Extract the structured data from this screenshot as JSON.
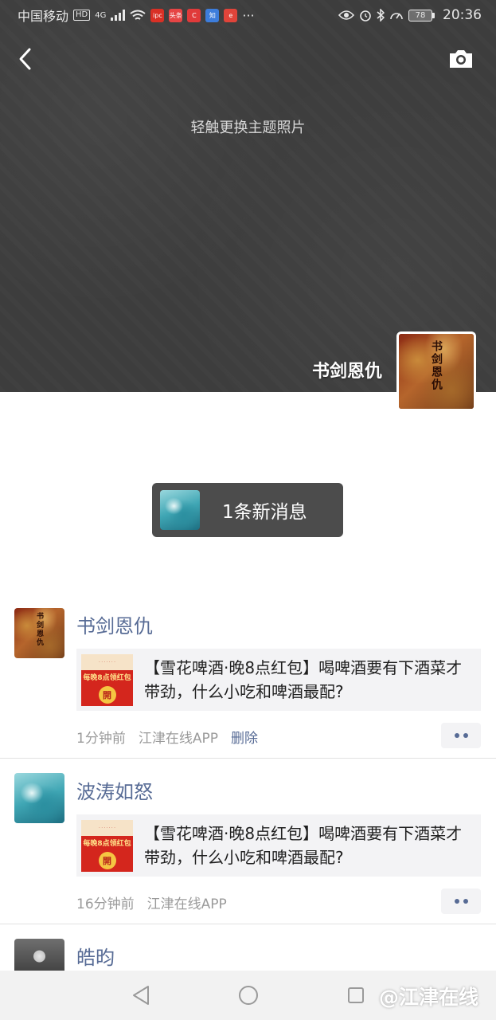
{
  "status_bar": {
    "carrier": "中国移动",
    "hd": "HD",
    "network": "4G",
    "battery": "78",
    "time": "20:36",
    "more": "···",
    "app_icons": [
      {
        "label": "ipc",
        "color": "#d93025"
      },
      {
        "label": "头条",
        "color": "#e64545"
      },
      {
        "label": "C",
        "color": "#e03a3a"
      },
      {
        "label": "知",
        "color": "#3d7ddb"
      },
      {
        "label": "e",
        "color": "#e0443a"
      }
    ]
  },
  "header": {
    "cover_hint": "轻触更换主题照片",
    "profile_name": "书剑恩仇",
    "back_icon": "chevron-left-icon",
    "camera_icon": "camera-icon"
  },
  "new_message": {
    "text": "1条新消息"
  },
  "posts": [
    {
      "name": "书剑恩仇",
      "share_title": "【雪花啤酒·晚8点红包】喝啤酒要有下酒菜才带劲，什么小吃和啤酒最配?",
      "thumb_text": "每晚8点领红包",
      "thumb_button": "開",
      "time": "1分钟前",
      "source": "江津在线APP",
      "delete": "删除"
    },
    {
      "name": "波涛如怒",
      "share_title": "【雪花啤酒·晚8点红包】喝啤酒要有下酒菜才带劲，什么小吃和啤酒最配?",
      "thumb_text": "每晚8点领红包",
      "thumb_button": "開",
      "time": "16分钟前",
      "source": "江津在线APP"
    },
    {
      "name": "皓昀"
    }
  ],
  "bottom_nav": {
    "back_icon": "triangle-back-icon",
    "home_icon": "circle-home-icon",
    "recents_icon": "square-recents-icon"
  },
  "watermark": "@江津在线"
}
